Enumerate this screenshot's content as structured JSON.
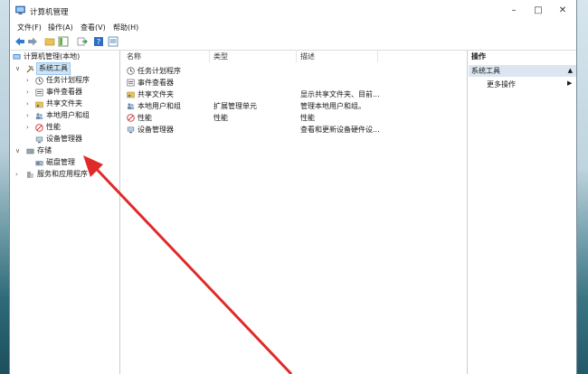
{
  "window": {
    "title": "计算机管理"
  },
  "menu": [
    "文件(F)",
    "操作(A)",
    "查看(V)",
    "帮助(H)"
  ],
  "tree": {
    "root": "计算机管理(本地)",
    "system_tools": "系统工具",
    "task_scheduler": "任务计划程序",
    "event_viewer": "事件查看器",
    "shared_folders": "共享文件夹",
    "local_users": "本地用户和组",
    "performance": "性能",
    "device_manager": "设备管理器",
    "storage": "存储",
    "disk_management": "磁盘管理",
    "services_apps": "服务和应用程序"
  },
  "list": {
    "headers": [
      "名称",
      "类型",
      "描述"
    ],
    "rows": [
      {
        "name": "任务计划程序",
        "type": "",
        "desc": "",
        "icon": "clock-icon"
      },
      {
        "name": "事件查看器",
        "type": "",
        "desc": "",
        "icon": "event-viewer-icon"
      },
      {
        "name": "共享文件夹",
        "type": "",
        "desc": "显示共享文件夹、目前...",
        "icon": "shared-folder-icon"
      },
      {
        "name": "本地用户和组",
        "type": "扩展管理单元",
        "desc": "管理本地用户和组。",
        "icon": "users-icon"
      },
      {
        "name": "性能",
        "type": "性能",
        "desc": "性能",
        "icon": "performance-icon"
      },
      {
        "name": "设备管理器",
        "type": "",
        "desc": "查看和更新设备硬件设...",
        "icon": "device-manager-icon"
      }
    ]
  },
  "actions": {
    "title": "操作",
    "section": "系统工具",
    "more": "更多操作"
  },
  "colors": {
    "arrow": "#e02a2a",
    "selection": "#cce4f7",
    "section_bg": "#dbe6f0"
  }
}
